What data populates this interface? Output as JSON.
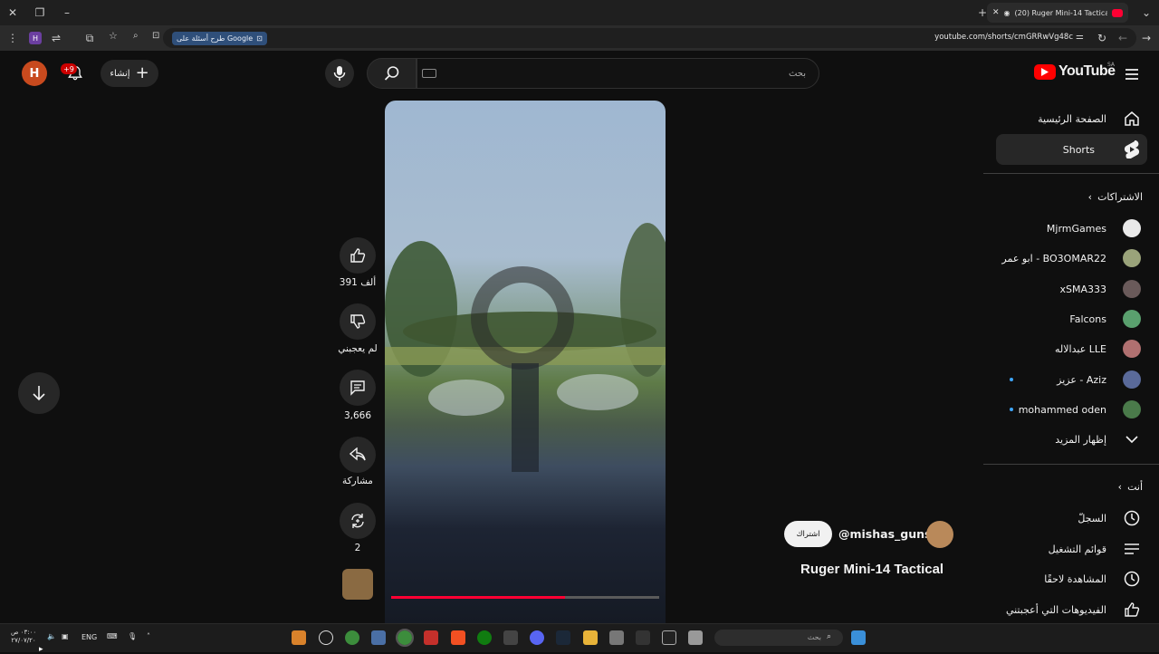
{
  "browser": {
    "tab_title": "(20) Ruger Mini-14 Tactical",
    "url": "youtube.com/shorts/cmGRRwVg48c",
    "google_chip": "طرح أسئلة على Google"
  },
  "header": {
    "avatar_letter": "H",
    "notifications": "+9",
    "create_label": "إنشاء",
    "search_placeholder": "بحث",
    "logo_text": "YouTube",
    "logo_region": "SA"
  },
  "sidebar": {
    "home": "الصفحة الرئيسية",
    "shorts": "Shorts",
    "subscriptions_title": "الاشتراكات",
    "subscriptions": [
      {
        "name": "MjrmGames",
        "color": "#e9e9e9"
      },
      {
        "name": "ابو عمر - BO3OMAR22",
        "color": "#9aa37a"
      },
      {
        "name": "xSMA333",
        "color": "#6a5a5a"
      },
      {
        "name": "Falcons",
        "color": "#5aa06e"
      },
      {
        "name": "عبدالاله LLE",
        "color": "#b07070"
      },
      {
        "name": "عزيز - Aziz",
        "color": "#5a6a9a"
      },
      {
        "name": "mohammed oden",
        "color": "#4a7a4a"
      }
    ],
    "show_more": "إظهار المزيد",
    "you_title": "أنت",
    "you_items": [
      "السجلّ",
      "قوائم التشغيل",
      "المشاهدة لاحقًا",
      "الفيديوهات التي أعجبتني"
    ]
  },
  "short": {
    "likes": "391 ألف",
    "dislike_label": "لم يعجبني",
    "comments": "3,666",
    "share_label": "مشاركة",
    "remix_count": "2",
    "subscribe_label": "اشتراك",
    "channel_handle": "@mishas_guns",
    "title": "Ruger Mini-14 Tactical",
    "progress": 0.65
  },
  "taskbar": {
    "lang": "ENG",
    "search_placeholder": "بحث",
    "time": "٠٣:٠٠ ص",
    "date": "٢٧/٠٧/٢٠"
  }
}
